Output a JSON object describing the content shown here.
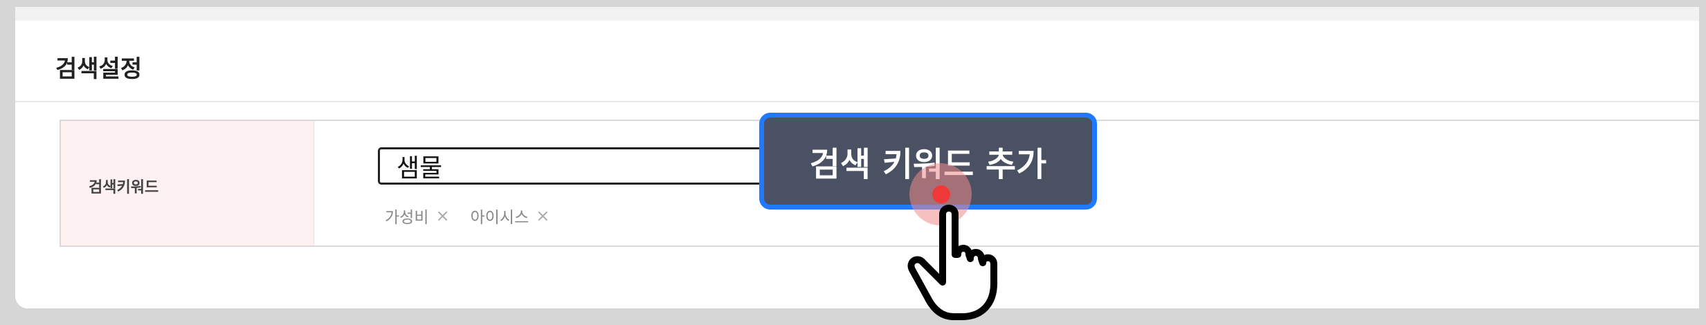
{
  "section": {
    "title": "검색설정"
  },
  "keyword_row": {
    "label": "검색키워드",
    "input_value": "샘물",
    "tags": [
      {
        "label": "가성비",
        "remove": "×"
      },
      {
        "label": "아이시스",
        "remove": "×"
      }
    ]
  },
  "tooltip": {
    "text": "검색 키워드 추가"
  },
  "colors": {
    "tooltip_bg": "#4a5163",
    "tooltip_border": "#1f7aff",
    "label_bg": "#fdf1f1",
    "click_dot": "#f03a3a"
  },
  "icons": {
    "cursor": "hand-pointer-icon"
  }
}
